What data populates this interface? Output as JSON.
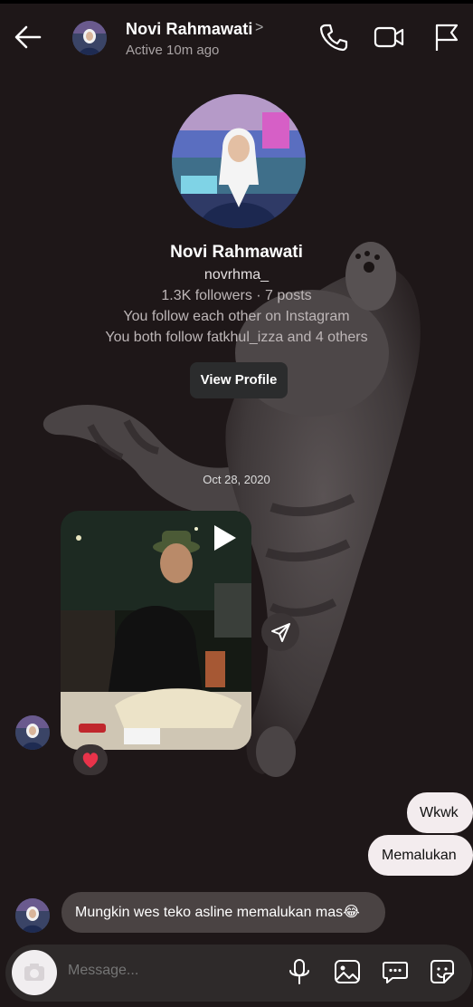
{
  "header": {
    "name": "Novi Rahmawati",
    "chevron": ">",
    "status": "Active 10m ago",
    "icons": [
      "back-arrow-icon",
      "phone-icon",
      "video-call-icon",
      "flag-icon"
    ]
  },
  "profile": {
    "name": "Novi Rahmawati",
    "username": "novrhma_",
    "stats": "1.3K followers · 7 posts",
    "follow_status": "You follow each other on Instagram",
    "mutual": "You both follow fatkhul_izza and 4 others",
    "view_button": "View Profile"
  },
  "chat": {
    "date": "Oct 28, 2020",
    "video_message": {
      "reaction": "heart",
      "icons": [
        "play-icon",
        "share-send-icon"
      ]
    },
    "messages": [
      {
        "from": "me",
        "text": "Wkwk"
      },
      {
        "from": "me",
        "text": "Memalukan"
      },
      {
        "from": "them",
        "text": "Mungkin wes teko asline memalukan mas😂"
      }
    ]
  },
  "composer": {
    "placeholder": "Message...",
    "icons": [
      "camera-icon",
      "microphone-icon",
      "gallery-icon",
      "chat-bubble-icon",
      "sticker-icon"
    ]
  },
  "colors": {
    "background": "#1e1718",
    "outgoing_bubble": "#f3ecee",
    "incoming_bubble": "#4a4343",
    "reaction_heart": "#e8334a"
  }
}
